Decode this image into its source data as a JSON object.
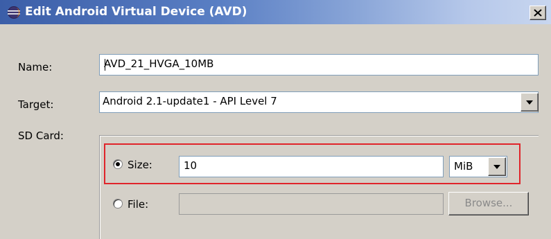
{
  "window": {
    "title": "Edit Android Virtual Device (AVD)",
    "icon": "eclipse-icon",
    "close_icon": "close-icon"
  },
  "form": {
    "name_label": "Name:",
    "name_value": "AVD_21_HVGA_10MB",
    "target_label": "Target:",
    "target_value": "Android 2.1-update1 - API Level 7",
    "sdcard_label": "SD Card:"
  },
  "sdcard": {
    "size_option_label": "Size:",
    "size_selected": true,
    "size_value": "10",
    "unit_value": "MiB",
    "file_option_label": "File:",
    "file_selected": false,
    "file_value": "",
    "browse_label": "Browse..."
  },
  "colors": {
    "highlight": "#e0242a",
    "titlebar_start": "#3b5ea8",
    "titlebar_end": "#c8d6ef"
  }
}
